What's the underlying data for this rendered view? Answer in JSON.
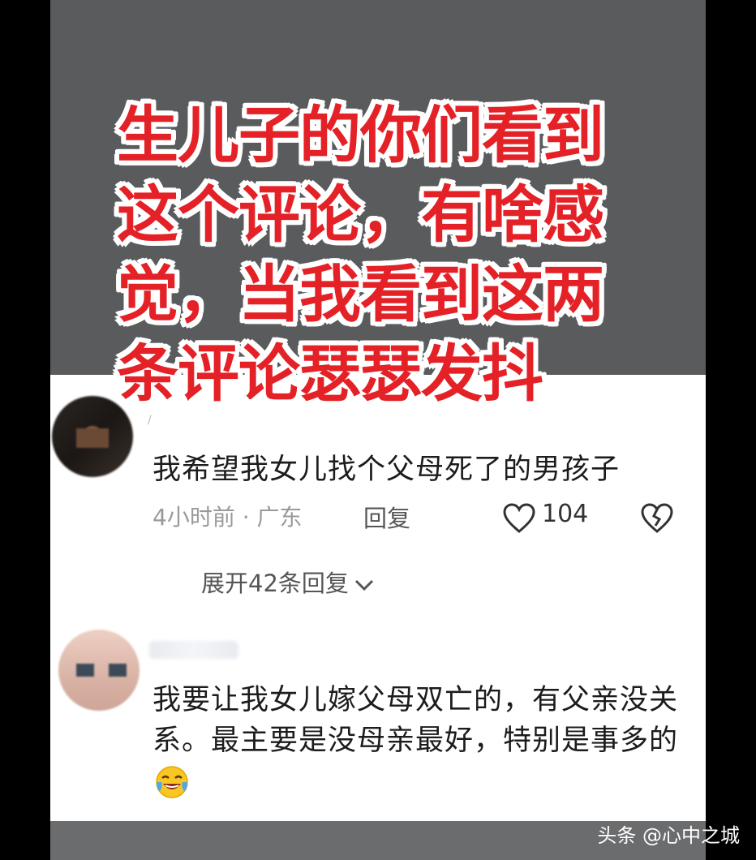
{
  "caption": {
    "lines": [
      "生儿子的你们看到",
      "这个评论，有啥感",
      "觉，当我看到这两",
      "条评论瑟瑟发抖"
    ]
  },
  "comment1": {
    "username": "/",
    "text": "我希望我女儿找个父母死了的男孩子",
    "time_location": "4小时前 · 广东",
    "reply_label": "回复",
    "like_count": "104",
    "expand_label": "展开42条回复"
  },
  "comment2": {
    "text": "我要让我女儿嫁父母双亡的，有父亲没关系。最主要是没母亲最好，特别是事多的",
    "emoji": "crying-laughing-emoji"
  },
  "watermark": "头条 @心中之城",
  "colors": {
    "caption_red": "#e32127",
    "caption_outline": "#ffffff",
    "top_background": "#5a5b5d"
  }
}
